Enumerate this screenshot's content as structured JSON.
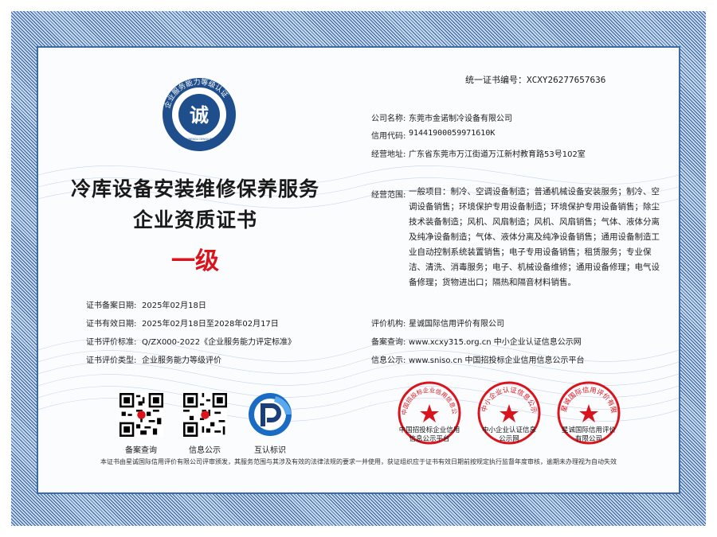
{
  "certificate": {
    "number_label": "统一证书编号：",
    "number": "XCXY26277657636",
    "title_line1": "冷库设备安装维修保养服务",
    "title_line2": "企业资质证书",
    "grade": "一级",
    "seal_top_text": "企业服务能力等级认证",
    "seal_center": "诚",
    "seal_bottom_text": "QIYE FUWUNENGLI DENGJI RENZHENG"
  },
  "company": {
    "name_label": "公司名称:",
    "name": "东莞市金诺制冷设备有限公司",
    "credit_label": "信用代码:",
    "credit": "91441900059971610K",
    "address_label": "经营地址:",
    "address": "广东省东莞市万江街道万江新村教育路53号102室",
    "scope_label": "经营范围:",
    "scope": "一般项目：制冷、空调设备制造；普通机械设备安装服务；制冷、空调设备销售；环境保护专用设备制造；环境保护专用设备销售；除尘技术装备制造；风机、风扇制造；风机、风扇销售；气体、液体分离及纯净设备制造；气体、液体分离及纯净设备销售；通用设备制造工业自动控制系统装置销售；电子专用设备销售；租赁服务；专业保洁、清洗、消毒服务；电子、机械设备维修；通用设备修理；电气设备修理；货物进出口；隔热和隔音材料销售。"
  },
  "details_left": {
    "filing_date_label": "证书备案日期:",
    "filing_date": "2025年02月18日",
    "validity_label": "证书有效日期:",
    "validity": "2025年02月18日至2028年02月17日",
    "standard_label": "证书评价标准:",
    "standard": "Q/ZX000-2022《企业服务能力评定标准》",
    "type_label": "证书评价类型:",
    "type": "企业服务能力等级评价"
  },
  "details_right": {
    "org_label": "评价机构:",
    "org": "星诚国际信用评价有限公司",
    "filing_label": "备案查询:",
    "filing": "www.xcxy315.org.cn 中小企业认证信息公示网",
    "info_label": "信息公示:",
    "info": "www.sniso.cn 中国招投标企业信用信息公示平台"
  },
  "qr_codes": [
    {
      "caption": "备案查询"
    },
    {
      "caption": "信息公示"
    },
    {
      "caption": "互认标识"
    }
  ],
  "stamps": [
    {
      "ring": "中国招投标企业信用信息公示平台",
      "line1": "中国招投标企业信用",
      "line2": "信息公示平台"
    },
    {
      "ring": "中小企业认证信息公示网",
      "line1": "中小企业认证信息",
      "line2": "公示网"
    },
    {
      "ring": "星诚国际信用评价有限公司",
      "line1": "星诚国际信用评价",
      "line2": "有限公司"
    }
  ],
  "footer": "本证书由星诚国际信用评价有限公司评审颁发，其服务范围与其涉及有效的法律法规的要求一并使用，获证组织应于证书有效日期前按规定执行监督年度审核，逾期未办理视为自动失效",
  "colors": {
    "border_blue": "#2f5f9a",
    "seal_blue": "#1f4e8c",
    "stamp_red": "#d9141c"
  }
}
